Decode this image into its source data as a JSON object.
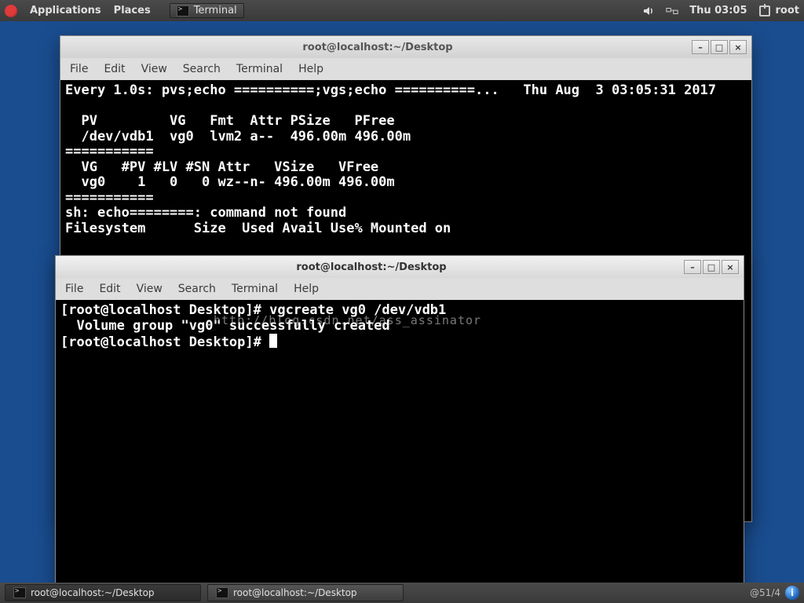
{
  "top_panel": {
    "menus": {
      "applications": "Applications",
      "places": "Places"
    },
    "running_app": "Terminal",
    "datetime": "Thu 03:05",
    "user": "root"
  },
  "windows": {
    "back": {
      "title": "root@localhost:~/Desktop",
      "menus": {
        "file": "File",
        "edit": "Edit",
        "view": "View",
        "search": "Search",
        "terminal": "Terminal",
        "help": "Help"
      },
      "content": "Every 1.0s: pvs;echo ==========;vgs;echo ==========...   Thu Aug  3 03:05:31 2017\n\n  PV         VG   Fmt  Attr PSize   PFree\n  /dev/vdb1  vg0  lvm2 a--  496.00m 496.00m\n===========\n  VG   #PV #LV #SN Attr   VSize   VFree\n  vg0    1   0   0 wz--n- 496.00m 496.00m\n===========\nsh: echo========: command not found\nFilesystem      Size  Used Avail Use% Mounted on"
    },
    "front": {
      "title": "root@localhost:~/Desktop",
      "menus": {
        "file": "File",
        "edit": "Edit",
        "view": "View",
        "search": "Search",
        "terminal": "Terminal",
        "help": "Help"
      },
      "content": "[root@localhost Desktop]# vgcreate vg0 /dev/vdb1\n  Volume group \"vg0\" successfully created\n[root@localhost Desktop]# "
    }
  },
  "watermark": "http://blog.csdn.net/ass_assinator",
  "bottom_panel": {
    "task1": "root@localhost:~/Desktop",
    "task2": "root@localhost:~/Desktop",
    "pager": "@51/4",
    "info": "i"
  }
}
